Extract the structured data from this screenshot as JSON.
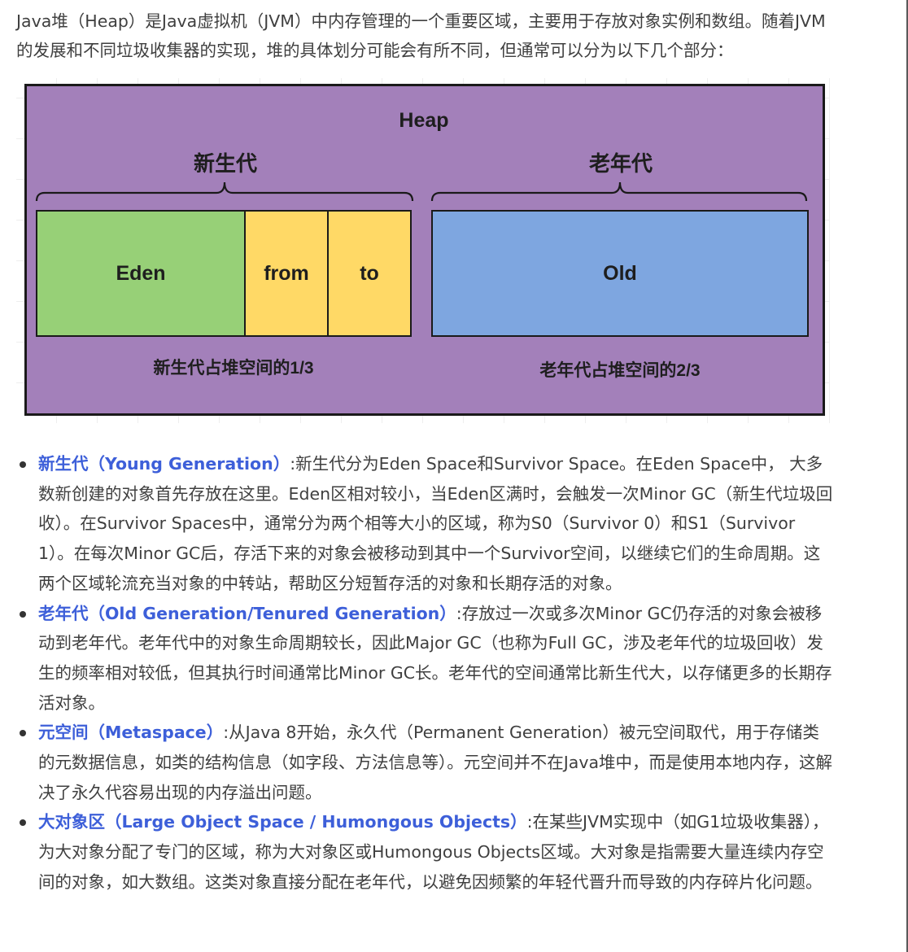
{
  "intro_text": "Java堆（Heap）是Java虚拟机（JVM）中内存管理的一个重要区域，主要用于存放对象实例和数组。随着JVM的发展和不同垃圾收集器的实现，堆的具体划分可能会有所不同，但通常可以分为以下几个部分：",
  "diagram": {
    "heap_label": "Heap",
    "young_gen_label": "新生代",
    "old_gen_label": "老年代",
    "cells": {
      "eden": "Eden",
      "from": "from",
      "to": "to",
      "old": "Old"
    },
    "young_caption": "新生代占堆空间的1/3",
    "old_caption": "老年代占堆空间的2/3",
    "colors": {
      "heap_background": "#a380ba",
      "eden": "#97d077",
      "survivor": "#ffd966",
      "old": "#7ea6e0"
    }
  },
  "bullets": [
    {
      "term": "新生代（Young Generation）",
      "text": ":新生代分为Eden Space和Survivor Space。在Eden Space中， 大多数新创建的对象首先存放在这里。Eden区相对较小，当Eden区满时，会触发一次Minor GC（新生代垃圾回收）。在Survivor Spaces中，通常分为两个相等大小的区域，称为S0（Survivor 0）和S1（Survivor 1）。在每次Minor GC后，存活下来的对象会被移动到其中一个Survivor空间，以继续它们的生命周期。这两个区域轮流充当对象的中转站，帮助区分短暂存活的对象和长期存活的对象。"
    },
    {
      "term": "老年代（Old Generation/Tenured Generation）",
      "text": ":存放过一次或多次Minor GC仍存活的对象会被移动到老年代。老年代中的对象生命周期较长，因此Major GC（也称为Full GC，涉及老年代的垃圾回收）发生的频率相对较低，但其执行时间通常比Minor GC长。老年代的空间通常比新生代大，以存储更多的长期存活对象。"
    },
    {
      "term": "元空间（Metaspace）",
      "text": ":从Java 8开始，永久代（Permanent Generation）被元空间取代，用于存储类的元数据信息，如类的结构信息（如字段、方法信息等）。元空间并不在Java堆中，而是使用本地内存，这解决了永久代容易出现的内存溢出问题。"
    },
    {
      "term": "大对象区（Large Object Space / Humongous Objects）",
      "text": ":在某些JVM实现中（如G1垃圾收集器），为大对象分配了专门的区域，称为大对象区或Humongous Objects区域。大对象是指需要大量连续内存空间的对象，如大数组。这类对象直接分配在老年代，以避免因频繁的年轻代晋升而导致的内存碎片化问题。"
    }
  ]
}
